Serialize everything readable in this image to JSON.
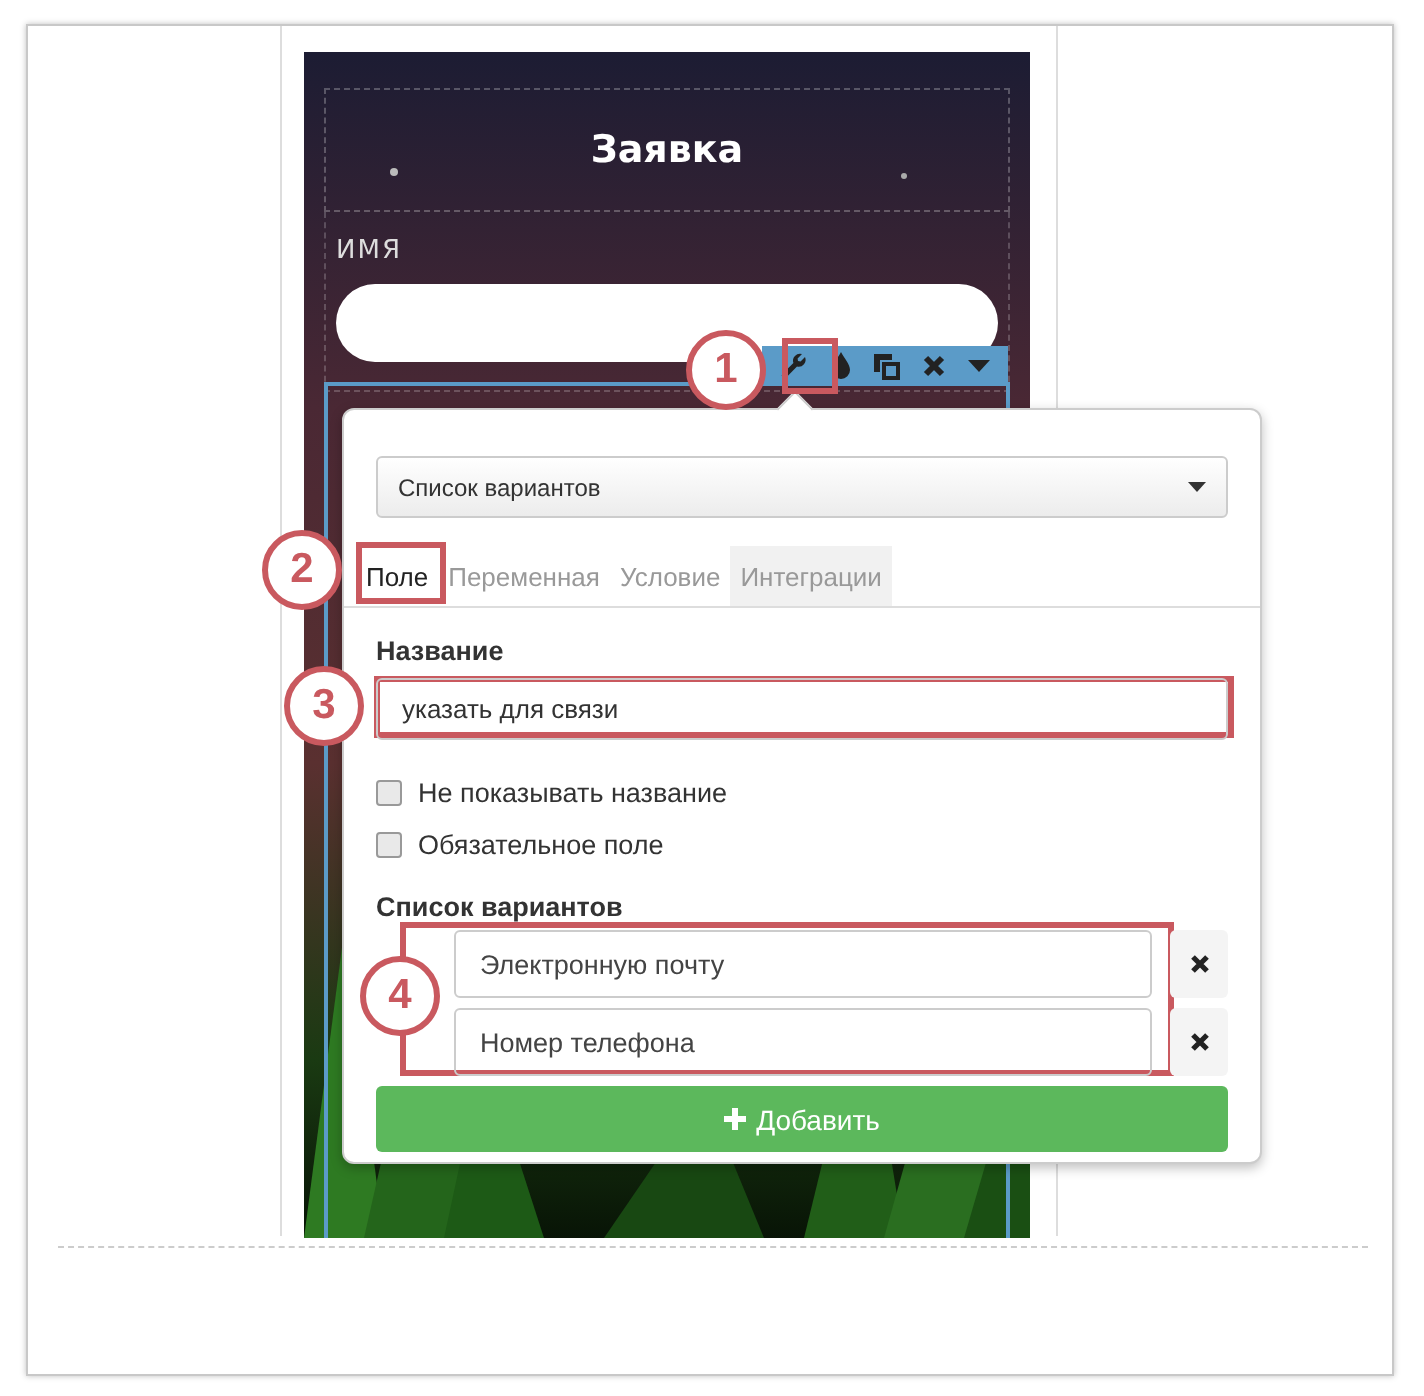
{
  "form": {
    "title": "Заявка",
    "name_label": "ИМЯ"
  },
  "popover": {
    "type_select": "Список вариантов",
    "tabs": [
      {
        "label": "Поле",
        "selected": true,
        "hovered": false
      },
      {
        "label": "Переменная",
        "selected": false,
        "hovered": false
      },
      {
        "label": "Условие",
        "selected": false,
        "hovered": false
      },
      {
        "label": "Интеграции",
        "selected": false,
        "hovered": true
      }
    ],
    "name_label": "Название",
    "name_value": "указать для связи",
    "checkboxes": [
      {
        "label": "Не показывать название",
        "checked": false
      },
      {
        "label": "Обязательное поле",
        "checked": false
      }
    ],
    "options_label": "Список вариантов",
    "options": [
      "Электронную почту",
      "Номер телефона"
    ],
    "add_button": "Добавить"
  },
  "callouts": [
    "1",
    "2",
    "3",
    "4"
  ]
}
